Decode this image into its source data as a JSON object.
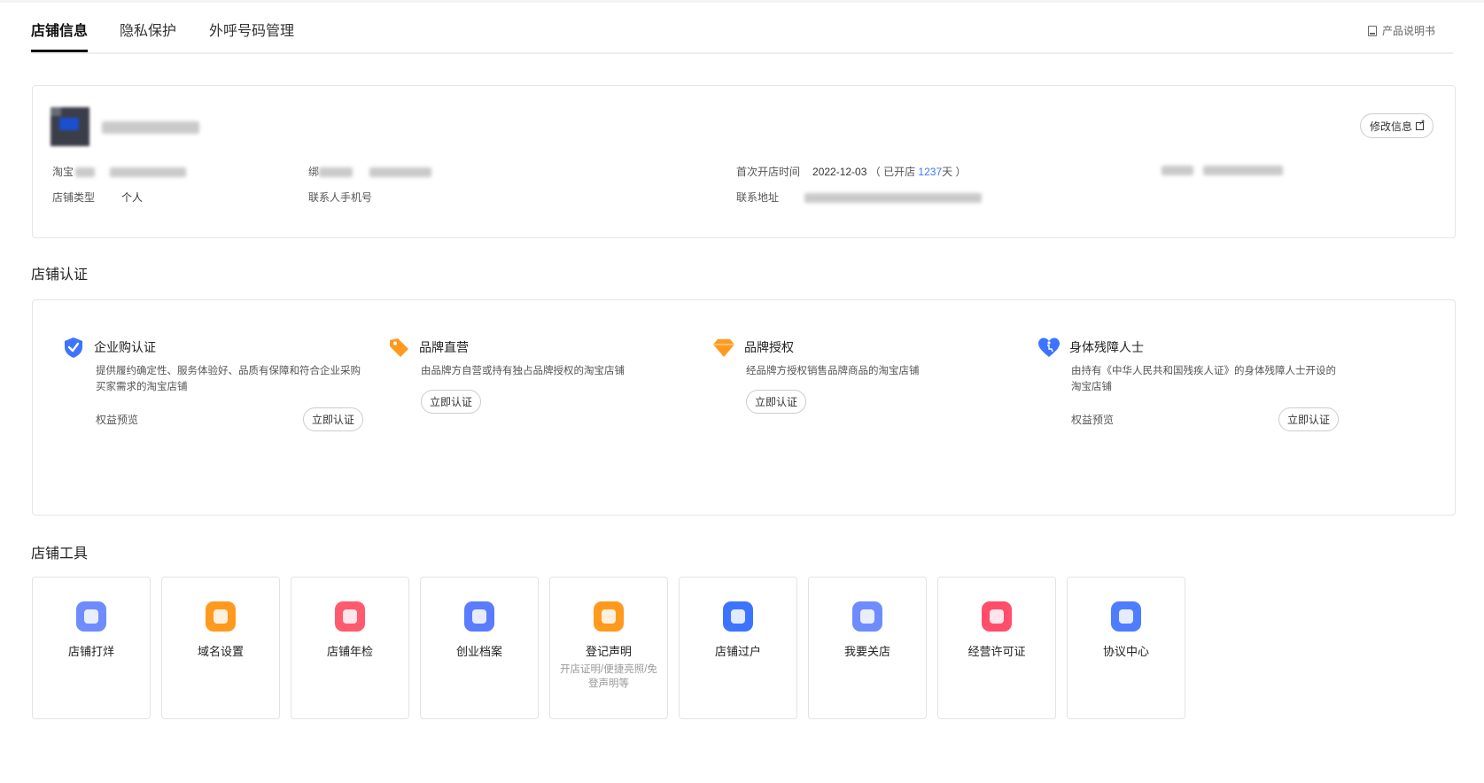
{
  "tabs": [
    "店铺信息",
    "隐私保护",
    "外呼号码管理"
  ],
  "manual_label": "产品说明书",
  "shop": {
    "edit_label": "修改信息",
    "fields": {
      "taobao_label": "淘宝",
      "bind_label": "绑",
      "open_time_label": "首次开店时间",
      "open_time_value": "2022-12-03",
      "opened_prefix": "（ 已开店 ",
      "opened_days": "1237",
      "opened_suffix": "天 ）",
      "shop_type_label": "店铺类型",
      "shop_type_value": "个人",
      "contact_phone_label": "联系人手机号",
      "address_label": "联系地址"
    }
  },
  "cert_section_title": "店铺认证",
  "certs": [
    {
      "title": "企业购认证",
      "desc": "提供履约确定性、服务体验好、品质有保障和符合企业采购买家需求的淘宝店铺",
      "benefit": "权益预览",
      "button": "立即认证",
      "icon": "shield-check-icon",
      "color": "#3d74ff"
    },
    {
      "title": "品牌直营",
      "desc": "由品牌方自营或持有独占品牌授权的淘宝店铺",
      "benefit": "",
      "button": "立即认证",
      "icon": "tag-icon",
      "color": "#ff9a1f"
    },
    {
      "title": "品牌授权",
      "desc": "经品牌方授权销售品牌商品的淘宝店铺",
      "benefit": "",
      "button": "立即认证",
      "icon": "diamond-icon",
      "color": "#ff9a1f"
    },
    {
      "title": "身体残障人士",
      "desc": "由持有《中华人民共和国残疾人证》的身体残障人士开设的淘宝店铺",
      "benefit": "权益预览",
      "button": "立即认证",
      "icon": "heart-accessibility-icon",
      "color": "#3d74ff"
    }
  ],
  "tools_section_title": "店铺工具",
  "tools": [
    {
      "label": "店铺打烊",
      "sub": "",
      "icon": "shop-close-icon",
      "color": "#6f8cff"
    },
    {
      "label": "域名设置",
      "sub": "",
      "icon": "domain-icon",
      "color": "#ff9a1f"
    },
    {
      "label": "店铺年检",
      "sub": "",
      "icon": "annual-check-icon",
      "color": "#ff5a6e"
    },
    {
      "label": "创业档案",
      "sub": "",
      "icon": "archive-icon",
      "color": "#5b7cff"
    },
    {
      "label": "登记声明",
      "sub": "开店证明/便捷亮照/免登声明等",
      "icon": "register-icon",
      "color": "#ff9a1f"
    },
    {
      "label": "店铺过户",
      "sub": "",
      "icon": "transfer-icon",
      "color": "#3d74ff"
    },
    {
      "label": "我要关店",
      "sub": "",
      "icon": "close-shop-icon",
      "color": "#6f8cff"
    },
    {
      "label": "经营许可证",
      "sub": "",
      "icon": "license-icon",
      "color": "#ff4d6a"
    },
    {
      "label": "协议中心",
      "sub": "",
      "icon": "agreement-icon",
      "color": "#4f7dff"
    }
  ]
}
